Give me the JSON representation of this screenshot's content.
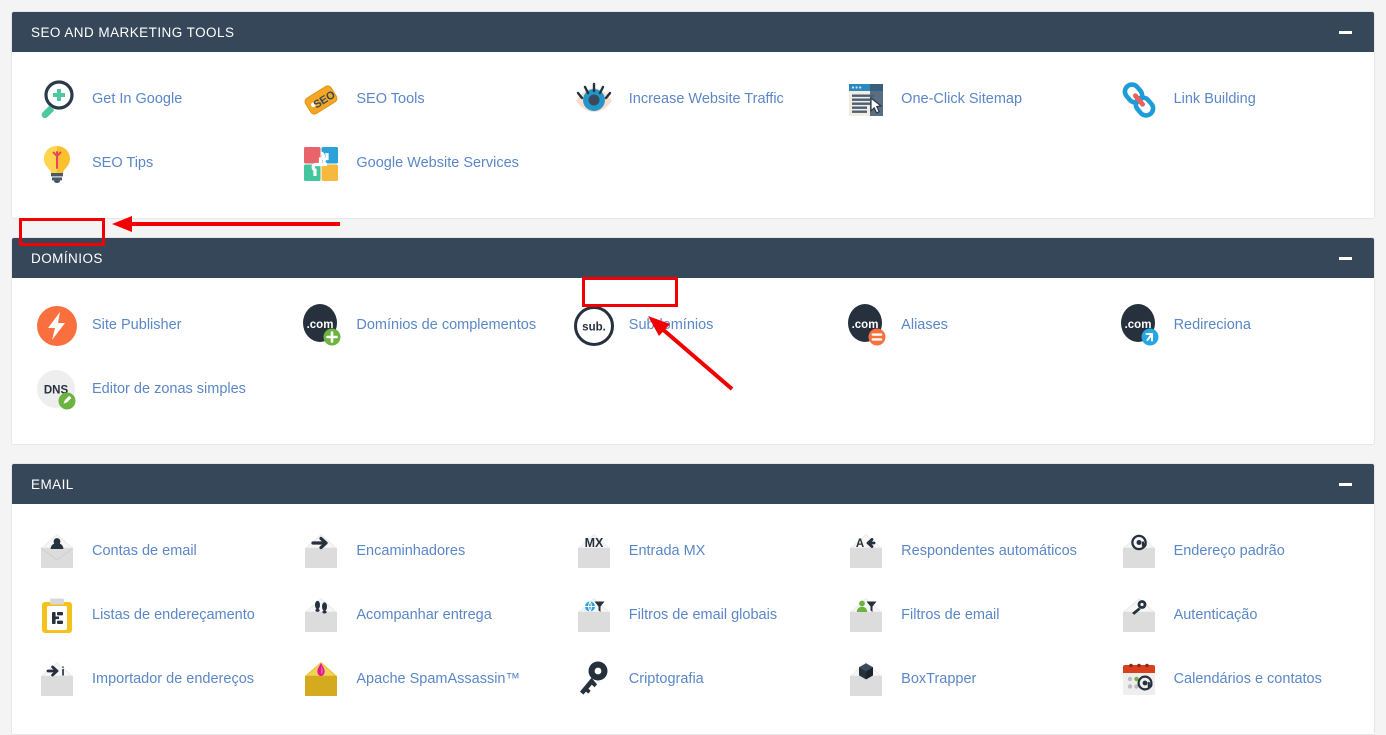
{
  "accent": {
    "header_bg": "#36475a",
    "link": "#5b87c7",
    "highlight": "#f20000",
    "page_bg": "#f4f4f4"
  },
  "sections": [
    {
      "id": "seo",
      "title": "SEO AND MARKETING TOOLS",
      "collapse_label": "−",
      "items": [
        {
          "label": "Get In Google",
          "icon": "magnifier-plus-icon"
        },
        {
          "label": "SEO Tools",
          "icon": "seo-tag-icon"
        },
        {
          "label": "Increase Website Traffic",
          "icon": "eye-icon"
        },
        {
          "label": "One-Click Sitemap",
          "icon": "sitemap-window-icon"
        },
        {
          "label": "Link Building",
          "icon": "chain-link-icon"
        },
        {
          "label": "SEO Tips",
          "icon": "lightbulb-icon"
        },
        {
          "label": "Google Website Services",
          "icon": "puzzle-icon"
        }
      ]
    },
    {
      "id": "dominios",
      "title": "DOMÍNIOS",
      "collapse_label": "−",
      "items": [
        {
          "label": "Site Publisher",
          "icon": "lightning-circle-icon"
        },
        {
          "label": "Domínios de complementos",
          "icon": "dotcom-plus-icon"
        },
        {
          "label": "Subdomínios",
          "icon": "sub-circle-icon"
        },
        {
          "label": "Aliases",
          "icon": "dotcom-equals-icon"
        },
        {
          "label": "Redireciona",
          "icon": "dotcom-redirect-icon"
        },
        {
          "label": "Editor de zonas simples",
          "icon": "dns-edit-icon"
        }
      ]
    },
    {
      "id": "email",
      "title": "EMAIL",
      "collapse_label": "−",
      "items": [
        {
          "label": "Contas de email",
          "icon": "envelope-person-icon"
        },
        {
          "label": "Encaminhadores",
          "icon": "envelope-arrow-icon"
        },
        {
          "label": "Entrada MX",
          "icon": "envelope-mx-icon"
        },
        {
          "label": "Respondentes automáticos",
          "icon": "envelope-autoreply-icon"
        },
        {
          "label": "Endereço padrão",
          "icon": "envelope-at-icon"
        },
        {
          "label": "Listas de endereçamento",
          "icon": "mailing-list-icon"
        },
        {
          "label": "Acompanhar entrega",
          "icon": "envelope-footprints-icon"
        },
        {
          "label": "Filtros de email globais",
          "icon": "envelope-globe-filter-icon"
        },
        {
          "label": "Filtros de email",
          "icon": "envelope-user-filter-icon"
        },
        {
          "label": "Autenticação",
          "icon": "envelope-key-icon"
        },
        {
          "label": "Importador de endereços",
          "icon": "envelope-import-icon"
        },
        {
          "label": "Apache SpamAssassin™",
          "icon": "envelope-spamassassin-icon"
        },
        {
          "label": "Criptografia",
          "icon": "key-icon"
        },
        {
          "label": "BoxTrapper",
          "icon": "envelope-box-icon"
        },
        {
          "label": "Calendários e contatos",
          "icon": "calendar-at-icon"
        }
      ]
    }
  ],
  "annotations": {
    "title_box": {
      "target": "DOMÍNIOS"
    },
    "link_box": {
      "target": "Subdomínios"
    },
    "arrow_horizontal": {
      "points_to": "DOMÍNIOS"
    },
    "arrow_diagonal": {
      "points_to": "Subdomínios"
    }
  }
}
